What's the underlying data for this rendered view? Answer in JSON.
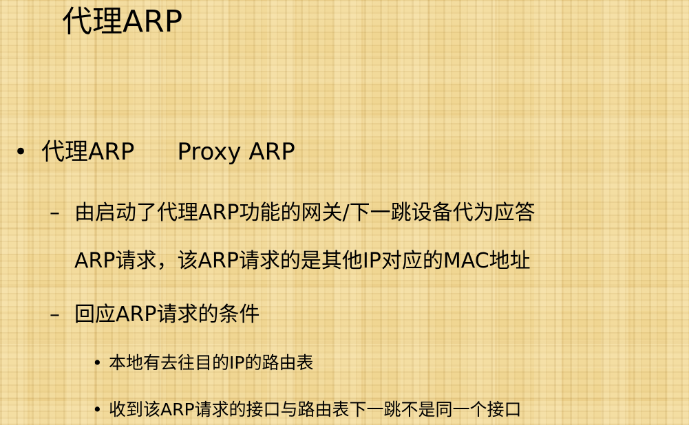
{
  "slide": {
    "title": "代理ARP",
    "bullet": {
      "marker": "•",
      "label": "代理ARP",
      "english": "Proxy ARP"
    },
    "sub_items": [
      {
        "marker": "–",
        "line1": "由启动了代理ARP功能的网关/下一跳设备代为应答",
        "line2": "ARP请求，该ARP请求的是其他IP对应的MAC地址"
      },
      {
        "marker": "–",
        "line1": "回应ARP请求的条件"
      }
    ],
    "conditions": [
      {
        "marker": "•",
        "text": "本地有去往目的IP的路由表"
      },
      {
        "marker": "•",
        "text": "收到该ARP请求的接口与路由表下一跳不是同一个接口"
      }
    ]
  },
  "colors": {
    "background": "#f0d692",
    "text": "#000000"
  }
}
